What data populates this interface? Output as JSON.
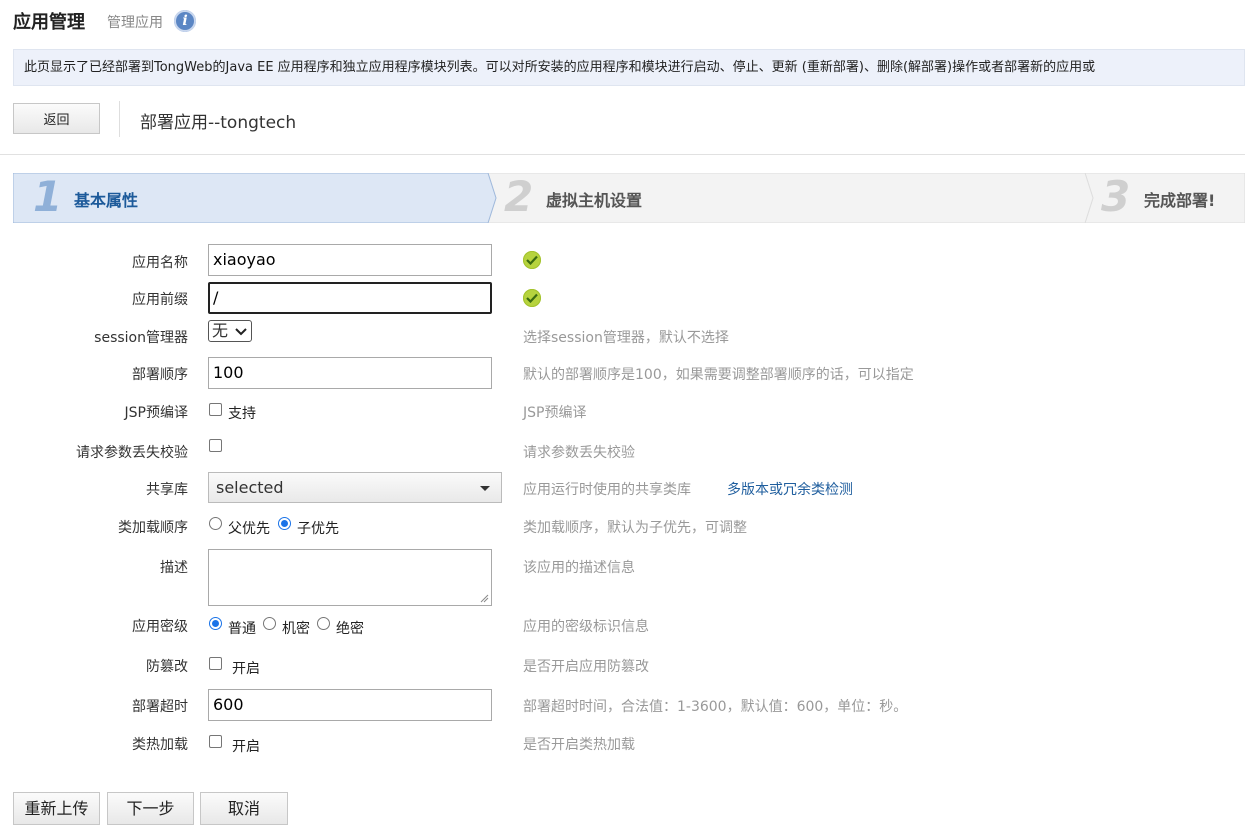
{
  "header": {
    "title": "应用管理",
    "subtitle": "管理应用",
    "info_icon": "info-icon",
    "notice": "此页显示了已经部署到TongWeb的Java EE 应用程序和独立应用程序模块列表。可以对所安装的应用程序和模块进行启动、停止、更新 (重新部署)、删除(解部署)操作或者部署新的应用或"
  },
  "toolbar": {
    "back_label": "返回",
    "deploy_title": "部署应用--tongtech"
  },
  "steps": [
    {
      "num": "1",
      "label": "基本属性",
      "active": true
    },
    {
      "num": "2",
      "label": "虚拟主机设置",
      "active": false
    },
    {
      "num": "3",
      "label": "完成部署!",
      "active": false
    }
  ],
  "form": {
    "app_name": {
      "label": "应用名称",
      "value": "xiaoyao"
    },
    "app_prefix": {
      "label": "应用前缀",
      "value": "/"
    },
    "session_manager": {
      "label": "session管理器",
      "value": "无",
      "hint": "选择session管理器，默认不选择"
    },
    "deploy_order": {
      "label": "部署顺序",
      "value": "100",
      "hint": "默认的部署顺序是100，如果需要调整部署顺序的话，可以指定"
    },
    "jsp_precompile": {
      "label": "JSP预编译",
      "option": "支持",
      "checked": false,
      "hint": "JSP预编译"
    },
    "param_loss_check": {
      "label": "请求参数丢失校验",
      "checked": false,
      "hint": "请求参数丢失校验"
    },
    "shared_lib": {
      "label": "共享库",
      "value": "selected",
      "hint": "应用运行时使用的共享类库",
      "link": "多版本或冗余类检测"
    },
    "classload_order": {
      "label": "类加载顺序",
      "options": [
        "父优先",
        "子优先"
      ],
      "selected": "子优先",
      "hint": "类加载顺序，默认为子优先，可调整"
    },
    "description": {
      "label": "描述",
      "value": "",
      "hint": "该应用的描述信息"
    },
    "security_level": {
      "label": "应用密级",
      "options": [
        "普通",
        "机密",
        "绝密"
      ],
      "selected": "普通",
      "hint": "应用的密级标识信息"
    },
    "tamper_proof": {
      "label": "防篡改",
      "option": "开启",
      "checked": false,
      "hint": "是否开启应用防篡改"
    },
    "deploy_timeout": {
      "label": "部署超时",
      "value": "600",
      "hint": "部署超时时间，合法值：1-3600，默认值：600，单位：秒。"
    },
    "hot_reload": {
      "label": "类热加载",
      "option": "开启",
      "checked": false,
      "hint": "是否开启类热加载"
    }
  },
  "footer": {
    "reupload_label": "重新上传",
    "next_label": "下一步",
    "cancel_label": "取消"
  },
  "colors": {
    "accent": "#1f5e9e",
    "step_active_bg": "#dde7f5",
    "step_inactive_bg": "#f1f1f1",
    "check_green": "#b6d33e"
  }
}
